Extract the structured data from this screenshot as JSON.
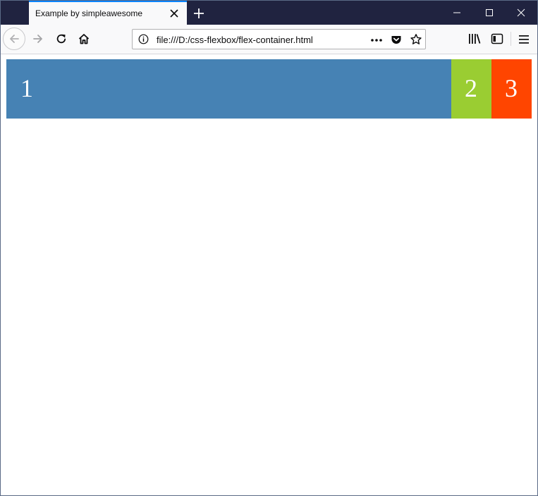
{
  "tab": {
    "title": "Example by simpleawesome"
  },
  "toolbar": {
    "url": "file:///D:/css-flexbox/flex-container.html"
  },
  "page": {
    "boxes": [
      {
        "label": "1",
        "color": "#4682b4"
      },
      {
        "label": "2",
        "color": "#9acd32"
      },
      {
        "label": "3",
        "color": "#ff4500"
      }
    ]
  },
  "icons": {
    "tab_close": "close-icon",
    "new_tab": "plus-icon",
    "minimize": "minimize-icon",
    "maximize": "maximize-icon",
    "close_window": "close-icon",
    "back": "back-arrow-icon",
    "forward": "forward-arrow-icon",
    "reload": "reload-icon",
    "home": "home-icon",
    "site_info": "info-icon",
    "page_actions": "more-dots-icon",
    "pocket": "pocket-icon",
    "bookmark": "star-icon",
    "library": "library-icon",
    "sidebar": "sidebar-icon",
    "menu": "hamburger-menu-icon"
  },
  "colors": {
    "tabstrip": "#202340",
    "accent": "#0a84ff"
  }
}
